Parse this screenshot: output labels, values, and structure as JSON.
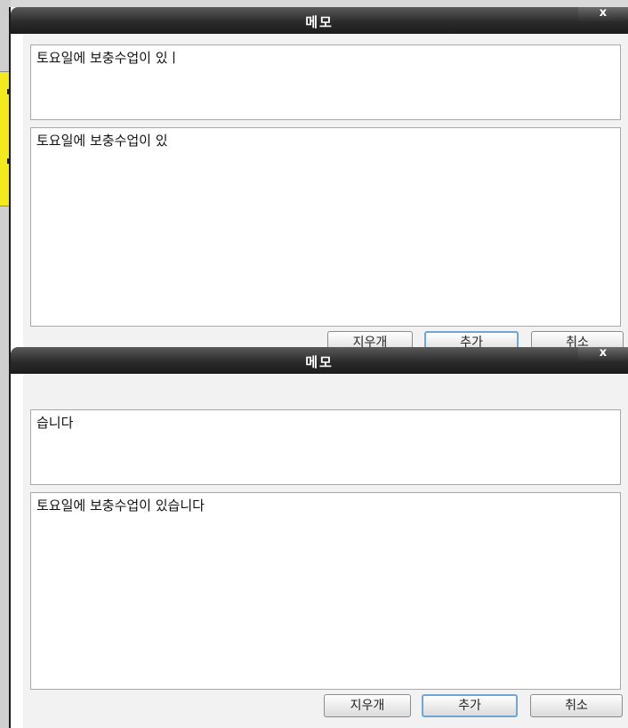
{
  "dialogs": [
    {
      "title": "메모",
      "close_label": "x",
      "input_text": "토요일에 보충수업이 있ㅣ",
      "memo_text": "토요일에 보충수업이 있",
      "buttons": {
        "clear": "지우개",
        "add": "추가",
        "cancel": "취소"
      }
    },
    {
      "title": "메모",
      "close_label": "x",
      "input_text": "습니다",
      "memo_text": "토요일에 보충수업이 있습니다",
      "buttons": {
        "clear": "지우개",
        "add": "추가",
        "cancel": "취소"
      }
    }
  ]
}
